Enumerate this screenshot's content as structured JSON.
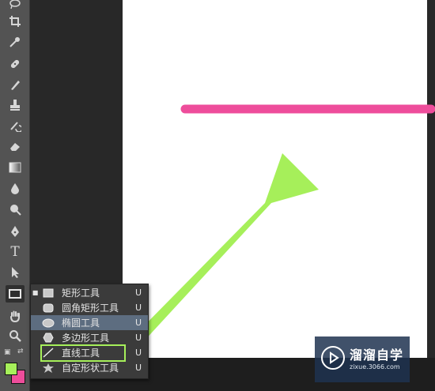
{
  "colors": {
    "toolbar": "#535353",
    "stroke_line": "#ee4d9b",
    "arrow_annotation": "#a6ef5a",
    "foreground_swatch": "#a6ef5a",
    "background_swatch": "#ee4d9b",
    "menu_hover": "#5d6d80"
  },
  "toolbar": {
    "tools": [
      {
        "name": "lasso-tool-icon"
      },
      {
        "name": "crop-tool-icon"
      },
      {
        "name": "eyedropper-tool-icon"
      },
      {
        "name": "healing-brush-tool-icon"
      },
      {
        "name": "brush-tool-icon"
      },
      {
        "name": "clone-stamp-tool-icon"
      },
      {
        "name": "history-brush-tool-icon"
      },
      {
        "name": "eraser-tool-icon"
      },
      {
        "name": "gradient-tool-icon"
      },
      {
        "name": "blur-tool-icon"
      },
      {
        "name": "dodge-tool-icon"
      },
      {
        "name": "pen-tool-icon"
      },
      {
        "name": "type-tool-icon",
        "glyph": "T"
      },
      {
        "name": "path-selection-tool-icon"
      },
      {
        "name": "rectangle-shape-tool-icon"
      },
      {
        "name": "hand-tool-icon"
      },
      {
        "name": "zoom-tool-icon"
      }
    ]
  },
  "shape_menu": {
    "items": [
      {
        "label": "矩形工具",
        "shortcut": "U",
        "icon": "rectangle-icon",
        "selected": true
      },
      {
        "label": "圆角矩形工具",
        "shortcut": "U",
        "icon": "rounded-rectangle-icon"
      },
      {
        "label": "椭圆工具",
        "shortcut": "U",
        "icon": "ellipse-icon",
        "hovered": true
      },
      {
        "label": "多边形工具",
        "shortcut": "U",
        "icon": "polygon-icon"
      },
      {
        "label": "直线工具",
        "shortcut": "U",
        "icon": "line-icon",
        "highlighted": true
      },
      {
        "label": "自定形状工具",
        "shortcut": "U",
        "icon": "custom-shape-icon"
      }
    ]
  },
  "watermark": {
    "title": "溜溜自学",
    "subtitle": "zixue.3066.com"
  }
}
